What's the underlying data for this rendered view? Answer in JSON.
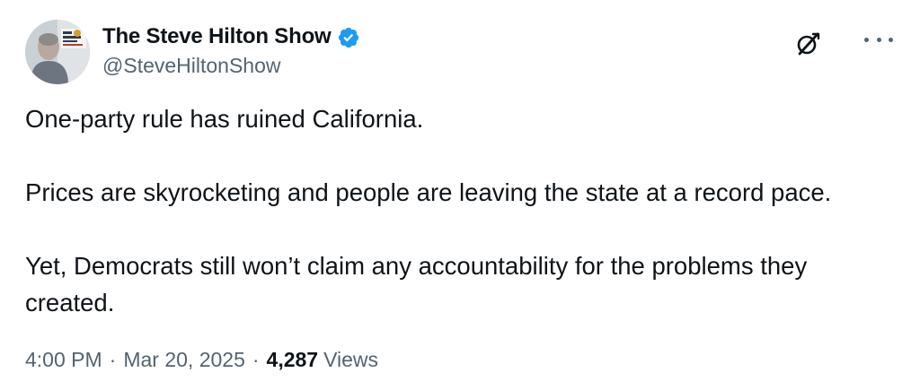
{
  "author": {
    "display_name": "The Steve Hilton Show",
    "handle": "@SteveHiltonShow",
    "verified": true,
    "avatar_icon": "avatar-photo",
    "verified_color": "#1d9bf0"
  },
  "header_actions": {
    "grok_icon": "grok-icon",
    "more_icon": "more-horizontal-icon"
  },
  "post": {
    "paragraphs": [
      "One-party rule has ruined California.",
      "Prices are skyrocketing and people are leaving the state at a record pace.",
      "Yet, Democrats still won’t claim any accountability for the problems they created."
    ]
  },
  "meta": {
    "time": "4:00 PM",
    "separator": "·",
    "date": "Mar 20, 2025",
    "views_count": "4,287",
    "views_label": "Views"
  },
  "colors": {
    "text_primary": "#0f1419",
    "text_secondary": "#536471",
    "accent": "#1d9bf0"
  }
}
